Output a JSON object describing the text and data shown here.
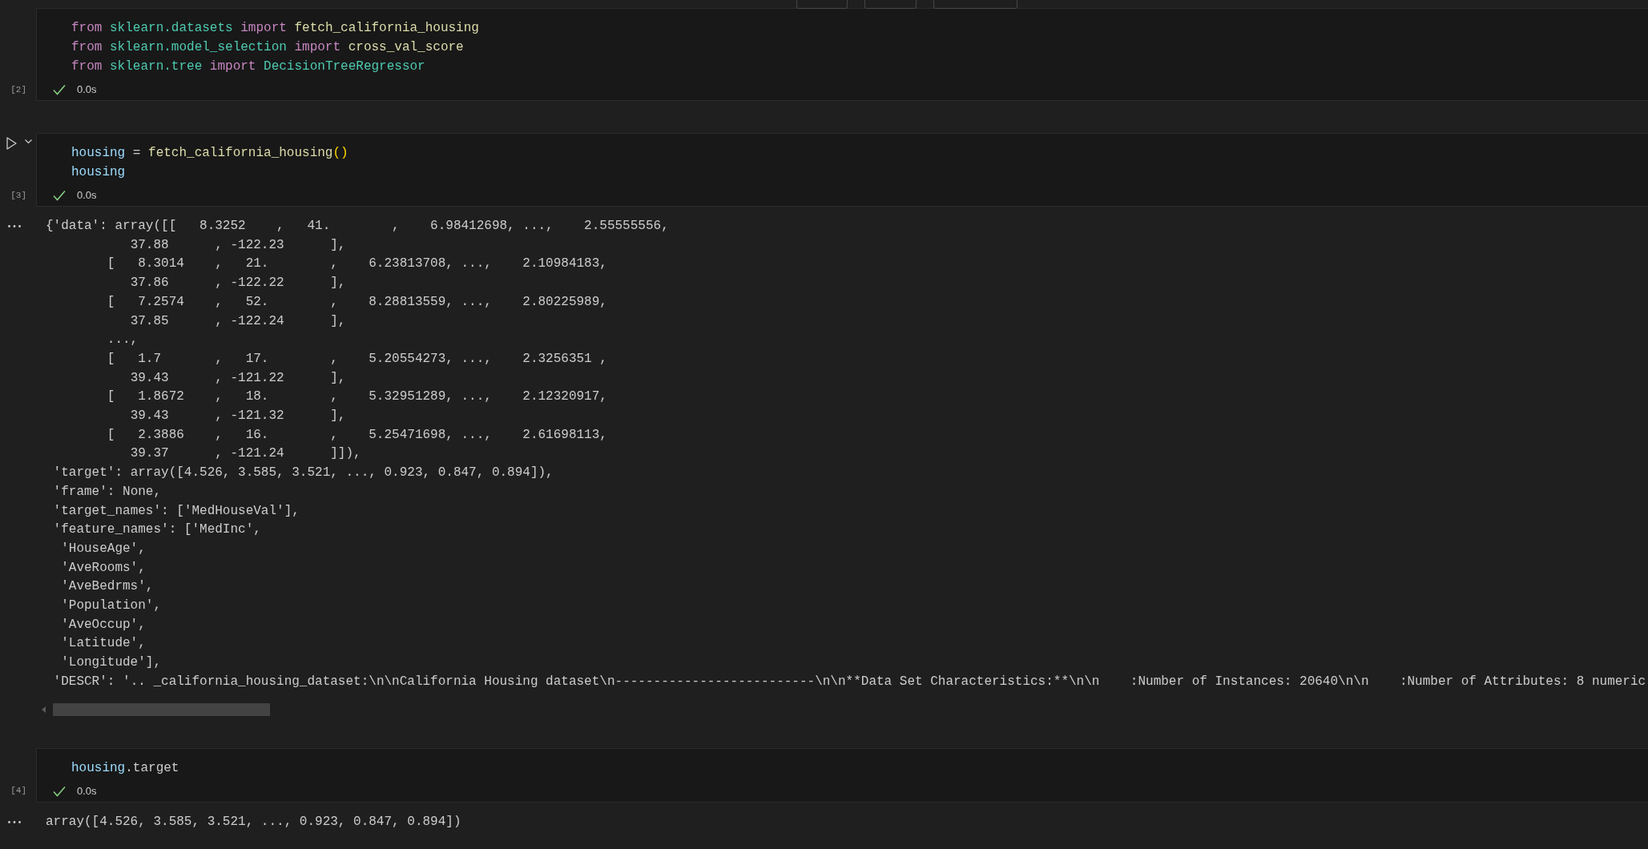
{
  "cells": [
    {
      "kind": "code",
      "execution_count": "[2]",
      "focused": false,
      "lines": [
        [
          {
            "text": "from ",
            "kind": "keyword"
          },
          {
            "text": "sklearn.datasets ",
            "kind": "module"
          },
          {
            "text": "import ",
            "kind": "keyword"
          },
          {
            "text": "fetch_california_housing",
            "kind": "function"
          }
        ],
        [
          {
            "text": "from ",
            "kind": "keyword"
          },
          {
            "text": "sklearn.model_selection ",
            "kind": "module"
          },
          {
            "text": "import ",
            "kind": "keyword"
          },
          {
            "text": "cross_val_score",
            "kind": "function"
          }
        ],
        [
          {
            "text": "from ",
            "kind": "keyword"
          },
          {
            "text": "sklearn.tree ",
            "kind": "module"
          },
          {
            "text": "import ",
            "kind": "keyword"
          },
          {
            "text": "DecisionTreeRegressor",
            "kind": "class"
          }
        ]
      ],
      "succeeded": true,
      "duration": "0.0s"
    },
    {
      "kind": "code",
      "execution_count": "[3]",
      "focused": true,
      "lines": [
        [
          {
            "text": "housing",
            "kind": "variable"
          },
          {
            "text": " = ",
            "kind": "plain"
          },
          {
            "text": "fetch_california_housing",
            "kind": "function"
          },
          {
            "text": "()",
            "kind": "bracket"
          }
        ],
        [
          {
            "text": "housing",
            "kind": "variable"
          }
        ]
      ],
      "succeeded": true,
      "duration": "0.0s",
      "output": {
        "horizontal_scrollbar": true,
        "lines": [
          "{'data': array([[   8.3252    ,   41.        ,    6.98412698, ...,    2.55555556,",
          "           37.88      , -122.23      ],",
          "        [   8.3014    ,   21.        ,    6.23813708, ...,    2.10984183,",
          "           37.86      , -122.22      ],",
          "        [   7.2574    ,   52.        ,    8.28813559, ...,    2.80225989,",
          "           37.85      , -122.24      ],",
          "        ...,",
          "        [   1.7       ,   17.        ,    5.20554273, ...,    2.3256351 ,",
          "           39.43      , -121.22      ],",
          "        [   1.8672    ,   18.        ,    5.32951289, ...,    2.12320917,",
          "           39.43      , -121.32      ],",
          "        [   2.3886    ,   16.        ,    5.25471698, ...,    2.61698113,",
          "           39.37      , -121.24      ]]),",
          " 'target': array([4.526, 3.585, 3.521, ..., 0.923, 0.847, 0.894]),",
          " 'frame': None,",
          " 'target_names': ['MedHouseVal'],",
          " 'feature_names': ['MedInc',",
          "  'HouseAge',",
          "  'AveRooms',",
          "  'AveBedrms',",
          "  'Population',",
          "  'AveOccup',",
          "  'Latitude',",
          "  'Longitude'],",
          " 'DESCR': '.. _california_housing_dataset:\\n\\nCalifornia Housing dataset\\n--------------------------\\n\\n**Data Set Characteristics:**\\n\\n    :Number of Instances: 20640\\n\\n    :Number of Attributes: 8 numeric"
        ]
      }
    },
    {
      "kind": "code",
      "execution_count": "[4]",
      "focused": false,
      "lines": [
        [
          {
            "text": "housing",
            "kind": "variable"
          },
          {
            "text": ".target",
            "kind": "plain"
          }
        ]
      ],
      "succeeded": true,
      "duration": "0.0s",
      "output": {
        "lines": [
          "array([4.526, 3.585, 3.521, ..., 0.923, 0.847, 0.894])"
        ]
      }
    }
  ]
}
